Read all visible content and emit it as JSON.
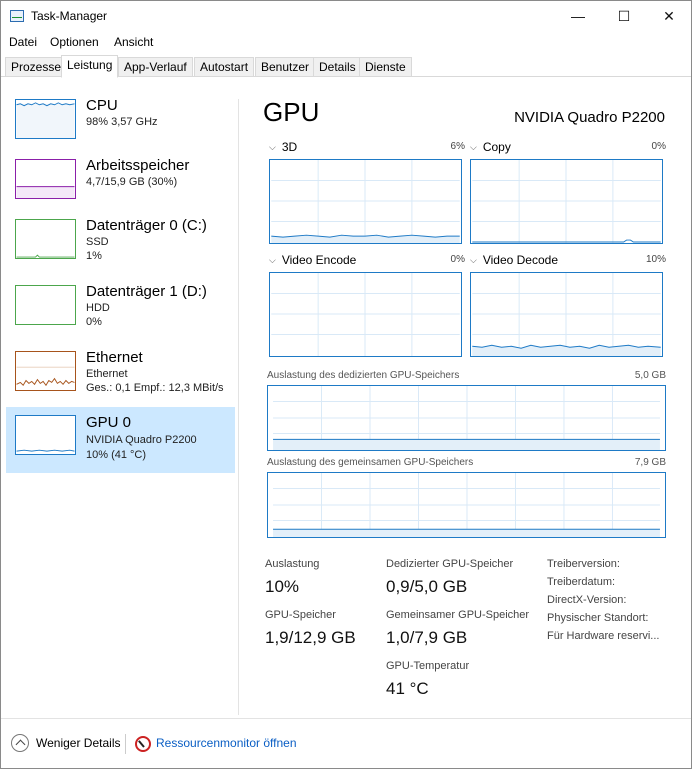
{
  "window": {
    "title": "Task-Manager"
  },
  "title_buttons": {
    "minimize": "—",
    "maximize": "☐",
    "close": "✕"
  },
  "menu": [
    {
      "label": "Datei"
    },
    {
      "label": "Optionen"
    },
    {
      "label": "Ansicht"
    }
  ],
  "tabs": [
    {
      "label": "Prozesse"
    },
    {
      "label": "Leistung"
    },
    {
      "label": "App-Verlauf"
    },
    {
      "label": "Autostart"
    },
    {
      "label": "Benutzer"
    },
    {
      "label": "Details"
    },
    {
      "label": "Dienste"
    }
  ],
  "sidebar": {
    "items": [
      {
        "name": "CPU",
        "line1": "98%  3,57 GHz",
        "line2": "",
        "line3": "",
        "color": "#1e7ac6"
      },
      {
        "name": "Arbeitsspeicher",
        "line1": "4,7/15,9 GB (30%)",
        "line2": "",
        "line3": "",
        "color": "#8b1fa9"
      },
      {
        "name": "Datenträger 0 (C:)",
        "line1": "SSD",
        "line2": "1%",
        "line3": "",
        "color": "#4ca64c"
      },
      {
        "name": "Datenträger 1 (D:)",
        "line1": "HDD",
        "line2": "0%",
        "line3": "",
        "color": "#4ca64c"
      },
      {
        "name": "Ethernet",
        "line1": "Ethernet",
        "line2": "Ges.: 0,1  Empf.: 12,3 MBit/s",
        "line3": "",
        "color": "#a7541c"
      },
      {
        "name": "GPU 0",
        "line1": "NVIDIA Quadro P2200",
        "line2": "10%  (41 °C)",
        "line3": "",
        "color": "#1e7ac6"
      }
    ],
    "selected_index": 5
  },
  "main": {
    "title": "GPU",
    "model": "NVIDIA Quadro P2200",
    "engines": [
      {
        "name": "3D",
        "percent": "6%"
      },
      {
        "name": "Copy",
        "percent": "0%"
      },
      {
        "name": "Video Encode",
        "percent": "0%"
      },
      {
        "name": "Video Decode",
        "percent": "10%"
      }
    ],
    "dedicated_memory": {
      "label": "Auslastung des dedizierten GPU-Speichers",
      "max": "5,0 GB"
    },
    "shared_memory": {
      "label": "Auslastung des gemeinsamen GPU-Speichers",
      "max": "7,9 GB"
    },
    "stats": {
      "utilization_label": "Auslastung",
      "utilization_value": "10%",
      "gpu_memory_label": "GPU-Speicher",
      "gpu_memory_value": "1,9/12,9 GB",
      "dedicated_label": "Dedizierter GPU-Speicher",
      "dedicated_value": "0,9/5,0 GB",
      "shared_label": "Gemeinsamer GPU-Speicher",
      "shared_value": "1,0/7,9 GB",
      "temp_label": "GPU-Temperatur",
      "temp_value": "41 °C"
    },
    "driver": {
      "version": "Treiberversion:",
      "date": "Treiberdatum:",
      "directx": "DirectX-Version:",
      "location": "Physischer Standort:",
      "reserved": "Für Hardware reservi..."
    }
  },
  "footer": {
    "fewer_details": "Weniger Details",
    "resource_monitor": "Ressourcenmonitor öffnen"
  },
  "colors": {
    "accent": "#1e7ac6",
    "selected_bg": "#cce8ff",
    "grid": "#d9e9f7"
  }
}
